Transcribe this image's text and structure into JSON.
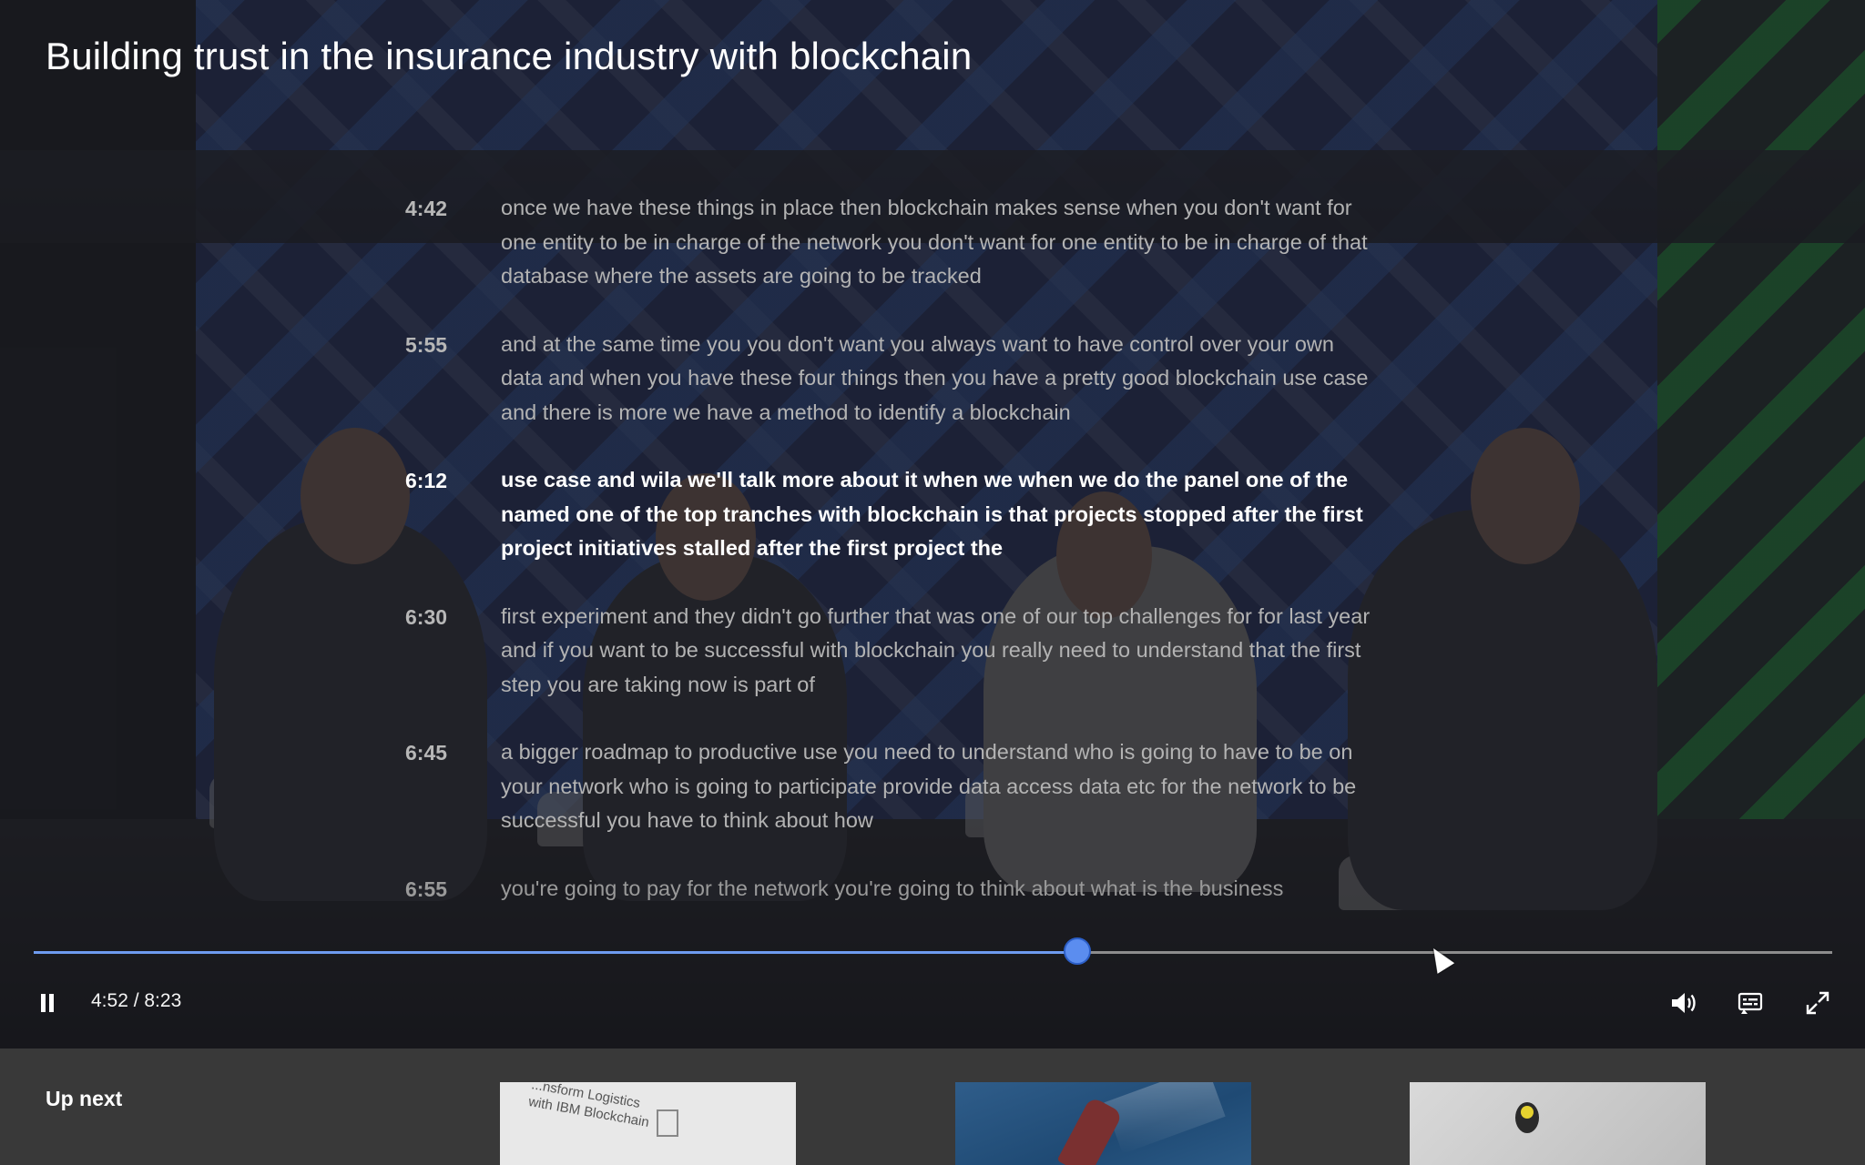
{
  "video": {
    "title": "Building trust in the insurance industry with blockchain",
    "current_time": "4:52",
    "duration": "8:23",
    "time_display": "4:52 / 8:23",
    "progress_fraction": 0.58
  },
  "transcript": [
    {
      "time": "4:42",
      "text": "once we have these things in place then blockchain makes sense when you don't want for one entity to be in charge of the network you don't want for one entity to be in charge of that database where the assets are going to be tracked",
      "state": "normal"
    },
    {
      "time": "5:55",
      "text": "and at the same time you you don't want you always want to have control over your own data and when you have these four things then you have a pretty good blockchain use case and there is more we have a method to identify a blockchain",
      "state": "normal"
    },
    {
      "time": "6:12",
      "text": "use case and wila we'll talk more about it when we when we do the panel one of the named one of the top tranches with blockchain is that projects stopped after the first project initiatives stalled after the first project the",
      "state": "active"
    },
    {
      "time": "6:30",
      "text": "first experiment and they didn't go further that was one of our top challenges for for last year and if you want to be successful with blockchain you really need to understand that the first step you are taking now is part of",
      "state": "normal"
    },
    {
      "time": "6:45",
      "text": "a bigger roadmap to productive use you need to understand who is going to have to be on your network who is going to participate provide data access data etc for the network to be successful you have to think about how",
      "state": "normal"
    },
    {
      "time": "6:55",
      "text": "you're going to pay for the network you're going to think about what is the business",
      "state": "faded"
    }
  ],
  "controls": {
    "pause_icon": "pause-icon",
    "volume_icon": "volume-icon",
    "captions_icon": "closed-captions-icon",
    "fullscreen_icon": "fullscreen-icon",
    "accent_color": "#5b8def"
  },
  "up_next": {
    "label": "Up next",
    "items": [
      {
        "thumb_text": "...nsform Logistics with IBM Blockchain"
      },
      {
        "thumb_text": ""
      },
      {
        "thumb_text": ""
      }
    ]
  }
}
